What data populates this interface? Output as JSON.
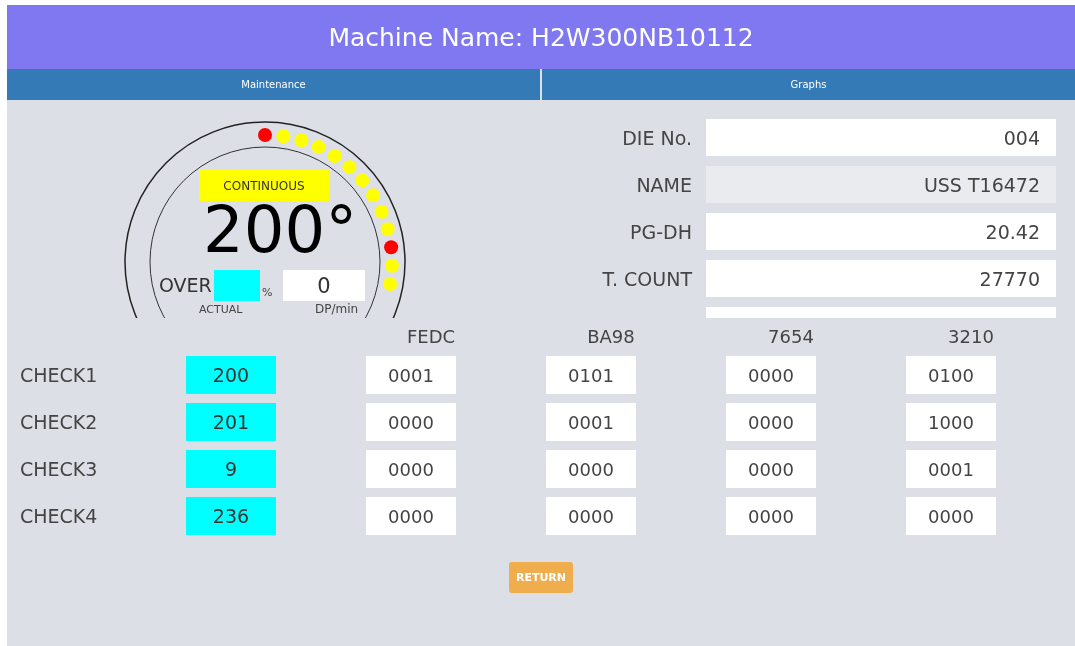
{
  "header": {
    "title": "Machine Name: H2W300NB10112"
  },
  "tabs": [
    {
      "label": "Maintenance",
      "selected": false
    },
    {
      "label": "Graphs",
      "selected": false
    }
  ],
  "gauge": {
    "mode": "CONTINUOUS",
    "value": "200°",
    "over_label": "OVER",
    "over_unit": "%",
    "rate": "0",
    "actual_label": "ACTUAL",
    "rate_unit": "DP/min",
    "lamps": [
      {
        "color": "#ff0000"
      },
      {
        "color": "#ffff00"
      },
      {
        "color": "#ffff00"
      },
      {
        "color": "#ffff00"
      },
      {
        "color": "#ffff00"
      },
      {
        "color": "#ffff00"
      },
      {
        "color": "#ffff00"
      },
      {
        "color": "#ffff00"
      },
      {
        "color": "#ffff00"
      },
      {
        "color": "#ffff00"
      },
      {
        "color": "#ff0000"
      },
      {
        "color": "#ffff00"
      },
      {
        "color": "#ffff00"
      }
    ]
  },
  "fields": [
    {
      "label": "DIE No.",
      "value": "004",
      "disabled": false
    },
    {
      "label": "NAME",
      "value": "USS T16472",
      "disabled": true
    },
    {
      "label": "PG-DH",
      "value": "20.42",
      "disabled": false
    },
    {
      "label": "T. COUNT",
      "value": "27770",
      "disabled": false
    }
  ],
  "checks": {
    "columns": [
      "FEDC",
      "BA98",
      "7654",
      "3210"
    ],
    "rows": [
      {
        "label": "CHECK1",
        "value": "200",
        "bits": [
          "0001",
          "0101",
          "0000",
          "0100"
        ]
      },
      {
        "label": "CHECK2",
        "value": "201",
        "bits": [
          "0000",
          "0001",
          "0000",
          "1000"
        ]
      },
      {
        "label": "CHECK3",
        "value": "9",
        "bits": [
          "0000",
          "0000",
          "0000",
          "0001"
        ]
      },
      {
        "label": "CHECK4",
        "value": "236",
        "bits": [
          "0000",
          "0000",
          "0000",
          "0000"
        ]
      }
    ]
  },
  "return_button": "RETURN"
}
